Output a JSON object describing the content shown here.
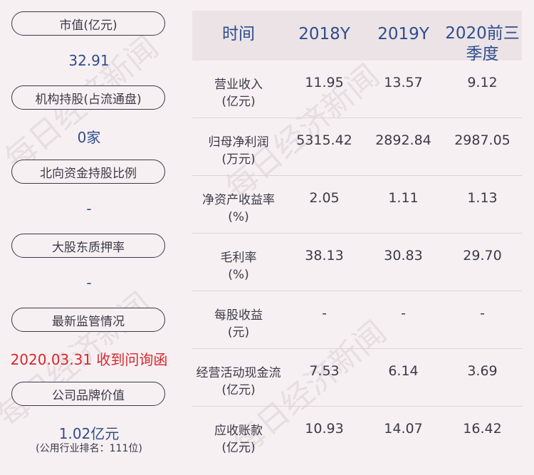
{
  "left": {
    "items": [
      {
        "label": "市值(亿元)",
        "value": "32.91"
      },
      {
        "label": "机构持股(占流通盘)",
        "value": "0家"
      },
      {
        "label": "北向资金持股比例",
        "value": "-"
      },
      {
        "label": "大股东质押率",
        "value": "-"
      },
      {
        "label": "最新监管情况",
        "value": "2020.03.31 收到问询函"
      },
      {
        "label": "公司品牌价值",
        "value": "1.02亿元",
        "note": "(公用行业排名：111位)"
      }
    ]
  },
  "table": {
    "headers": [
      "时间",
      "2018Y",
      "2019Y",
      "2020前三季度"
    ],
    "rows": [
      {
        "label": [
          "营业收入",
          "(亿元)"
        ],
        "values": [
          "11.95",
          "13.57",
          "9.12"
        ]
      },
      {
        "label": [
          "归母净利润",
          "(万元)"
        ],
        "values": [
          "5315.42",
          "2892.84",
          "2987.05"
        ]
      },
      {
        "label": [
          "净资产收益率",
          "(%)"
        ],
        "values": [
          "2.05",
          "1.11",
          "1.13"
        ]
      },
      {
        "label": [
          "毛利率",
          "(%)"
        ],
        "values": [
          "38.13",
          "30.83",
          "29.70"
        ]
      },
      {
        "label": [
          "每股收益",
          "(元)"
        ],
        "values": [
          "-",
          "-",
          "-"
        ]
      },
      {
        "label": [
          "经营活动现金流",
          "(亿元)"
        ],
        "values": [
          "7.53",
          "6.14",
          "3.69"
        ]
      },
      {
        "label": [
          "应收账款",
          "(亿元)"
        ],
        "values": [
          "10.93",
          "14.07",
          "16.42"
        ]
      }
    ]
  },
  "watermark": "每日经济新闻",
  "colors": {
    "background": "#f7f0f2",
    "header_bg": "#ebe3e6",
    "accent_blue": "#2f4d8c",
    "alert_red": "#d7282e"
  }
}
